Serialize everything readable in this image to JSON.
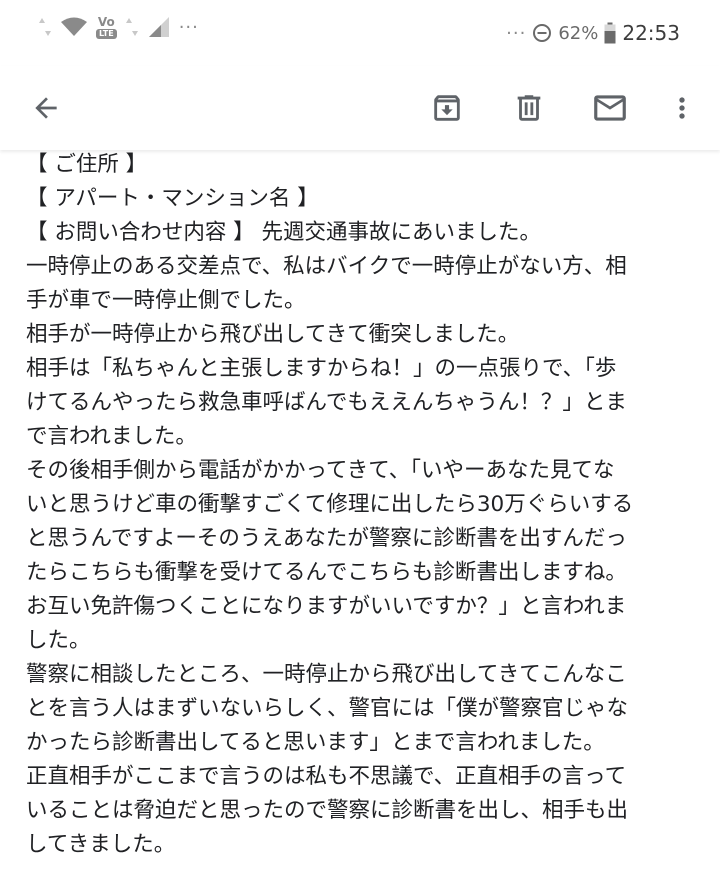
{
  "status_bar": {
    "dots_left": "···",
    "volte_vo": "Vo",
    "volte_lte": "LTE",
    "dots_right": "···",
    "battery_percent": "62%",
    "time": "22:53"
  },
  "toolbar": {
    "icons": [
      "back-arrow-icon",
      "archive-icon",
      "delete-icon",
      "mail-icon",
      "more-vert-icon"
    ]
  },
  "colors": {
    "icon_gray": "#5f6368",
    "text": "#202124",
    "status_gray": "#8a8a8a"
  },
  "message": {
    "lines": [
      "【 ご住所 】",
      "【 アパート・マンション名 】",
      "【 お問い合わせ内容 】 先週交通事故にあいました。",
      "一時停止のある交差点で、私はバイクで一時停止がない方、相",
      "手が車で一時停止側でした。",
      "相手が一時停止から飛び出してきて衝突しました。",
      "相手は「私ちゃんと主張しますからね！」の一点張りで、「歩",
      "けてるんやったら救急車呼ばんでもええんちゃうん！？」とま",
      "で言われました。",
      "その後相手側から電話がかかってきて、「いやーあなた見てな",
      "いと思うけど車の衝撃すごくて修理に出したら30万ぐらいする",
      "と思うんですよーそのうえあなたが警察に診断書を出すんだっ",
      "たらこちらも衝撃を受けてるんでこちらも診断書出しますね。",
      "お互い免許傷つくことになりますがいいですか？」と言われま",
      "した。",
      "警察に相談したところ、一時停止から飛び出してきてこんなこ",
      "とを言う人はまずいないらしく、警官には「僕が警察官じゃな",
      "かったら診断書出してると思います」とまで言われました。",
      "正直相手がここまで言うのは私も不思議で、正直相手の言って",
      "いることは脅迫だと思ったので警察に診断書を出し、相手も出",
      "してきました。"
    ]
  }
}
